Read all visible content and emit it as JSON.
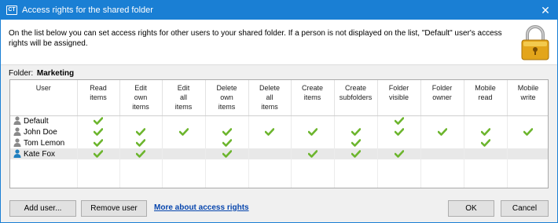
{
  "window": {
    "title": "Access rights for the shared folder",
    "app_icon_text": "CT",
    "close_glyph": "✕"
  },
  "info": {
    "text": "On the list below you can set access rights for other users to your shared folder. If a person is not displayed on the list, \"Default\" user's access rights will be assigned.",
    "icon": "padlock-icon"
  },
  "folder": {
    "label": "Folder:",
    "name": "Marketing"
  },
  "table": {
    "columns": [
      "User",
      "Read\nitems",
      "Edit\nown\nitems",
      "Edit\nall\nitems",
      "Delete\nown\nitems",
      "Delete\nall\nitems",
      "Create\nitems",
      "Create\nsubfolders",
      "Folder\nvisible",
      "Folder\nowner",
      "Mobile\nread",
      "Mobile\nwrite"
    ],
    "rows": [
      {
        "user": "Default",
        "rights": [
          true,
          false,
          false,
          false,
          false,
          false,
          false,
          true,
          false,
          false,
          false
        ],
        "selected": false,
        "icon_color": "#8a8a8a"
      },
      {
        "user": "John Doe",
        "rights": [
          true,
          true,
          true,
          true,
          true,
          true,
          true,
          true,
          true,
          true,
          true
        ],
        "selected": false,
        "icon_color": "#8a8a8a"
      },
      {
        "user": "Tom Lemon",
        "rights": [
          true,
          true,
          false,
          true,
          false,
          false,
          true,
          false,
          false,
          true,
          false
        ],
        "selected": false,
        "icon_color": "#8a8a8a"
      },
      {
        "user": "Kate Fox",
        "rights": [
          true,
          true,
          false,
          true,
          false,
          true,
          true,
          true,
          false,
          false,
          false
        ],
        "selected": true,
        "icon_color": "#1f7fbf"
      }
    ],
    "check_color": "#6cb52d"
  },
  "buttons": {
    "add_user": "Add user...",
    "remove_user": "Remove user",
    "more_link": "More about access rights",
    "ok": "OK",
    "cancel": "Cancel"
  }
}
